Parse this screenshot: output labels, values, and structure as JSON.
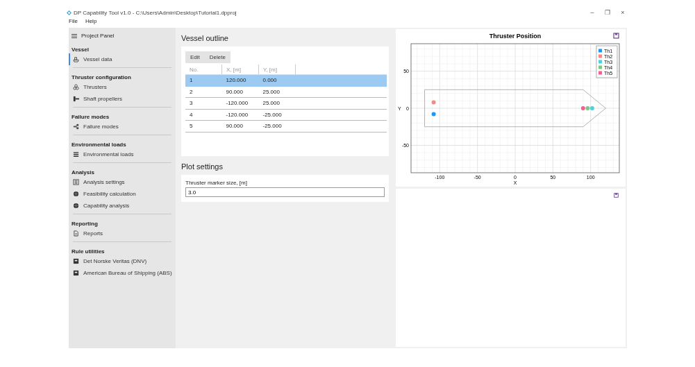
{
  "window": {
    "title": "DP Capability Tool v1.0 - C:\\Users\\Admin\\Desktop\\Tutorial1.dpproj",
    "controls": [
      "–",
      "❐",
      "×"
    ]
  },
  "menu": [
    "File",
    "Help"
  ],
  "sidebar": {
    "title": "Project Panel",
    "sections": [
      {
        "header": "Vessel",
        "items": [
          {
            "label": "Vessel data",
            "kind": "ship",
            "selected": true
          }
        ]
      },
      {
        "header": "Thruster configuration",
        "items": [
          {
            "label": "Thrusters",
            "kind": "fan",
            "selected": false
          },
          {
            "label": "Shaft propellers",
            "kind": "shaft",
            "selected": false
          }
        ]
      },
      {
        "header": "Failure modes",
        "items": [
          {
            "label": "Failure modes",
            "kind": "network",
            "selected": false
          }
        ]
      },
      {
        "header": "Environmental loads",
        "items": [
          {
            "label": "Environmental loads",
            "kind": "waves",
            "selected": false
          }
        ]
      },
      {
        "header": "Analysis",
        "items": [
          {
            "label": "Analysis settings",
            "kind": "sliders",
            "selected": false
          },
          {
            "label": "Feasibility calculation",
            "kind": "globe",
            "selected": false
          },
          {
            "label": "Capability analysis",
            "kind": "globe",
            "selected": false
          }
        ]
      },
      {
        "header": "Reporting",
        "items": [
          {
            "label": "Reports",
            "kind": "doc",
            "selected": false
          }
        ]
      },
      {
        "header": "Rule utilities",
        "items": [
          {
            "label": "Det Norske Veritas (DNV)",
            "kind": "book",
            "selected": false
          },
          {
            "label": "American Bureau of Shipping (ABS)",
            "kind": "book",
            "selected": false
          }
        ]
      }
    ]
  },
  "vessel_outline": {
    "title": "Vessel outline",
    "buttons": [
      "Edit",
      "Delete"
    ],
    "table": {
      "columns": [
        "No.",
        "X, [m]",
        "Y, [m]"
      ],
      "rows": [
        {
          "cells": [
            "1",
            "120.000",
            "0.000"
          ],
          "selected": true
        },
        {
          "cells": [
            "2",
            "90.000",
            "25.000"
          ],
          "selected": false
        },
        {
          "cells": [
            "3",
            "-120.000",
            "25.000"
          ],
          "selected": false
        },
        {
          "cells": [
            "4",
            "-120.000",
            "-25.000"
          ],
          "selected": false
        },
        {
          "cells": [
            "5",
            "90.000",
            "-25.000"
          ],
          "selected": false
        }
      ]
    }
  },
  "plot_settings": {
    "title": "Plot settings",
    "field": {
      "label": "Thruster marker size, [m]",
      "value": "3.0"
    }
  },
  "thruster_plot": {
    "chart_data": {
      "type": "scatter",
      "title": "Thruster Position",
      "xlabel": "X",
      "ylabel": "Y",
      "grid": true,
      "legend": "top-right",
      "xlim": [
        -138,
        138
      ],
      "ylim": [
        -87,
        87
      ],
      "xticks": [
        -100,
        -50,
        0,
        50,
        100
      ],
      "yticks": [
        -50,
        0,
        50
      ],
      "series": [
        {
          "name": "Th1",
          "color": "#2196f3",
          "x": [
            -108
          ],
          "values": [
            -8
          ]
        },
        {
          "name": "Th2",
          "color": "#f28b82",
          "x": [
            -108
          ],
          "values": [
            8
          ]
        },
        {
          "name": "Th3",
          "color": "#4dd0e1",
          "x": [
            102
          ],
          "values": [
            0
          ]
        },
        {
          "name": "Th4",
          "color": "#81c784",
          "x": [
            96
          ],
          "values": [
            0
          ]
        },
        {
          "name": "Th5",
          "color": "#f06292",
          "x": [
            90
          ],
          "values": [
            0
          ]
        }
      ]
    }
  }
}
